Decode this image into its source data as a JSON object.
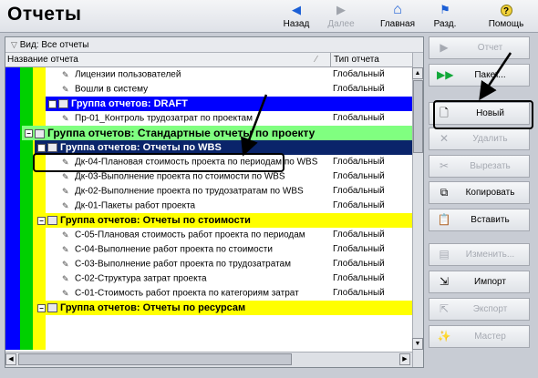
{
  "window": {
    "title": "Отчеты"
  },
  "nav": [
    {
      "label": "Назад",
      "icon": "arrow-left-icon",
      "glyph": "◀",
      "enabled": true
    },
    {
      "label": "Далее",
      "icon": "arrow-right-icon",
      "glyph": "▶",
      "enabled": false
    },
    {
      "label": "Главная",
      "icon": "home-icon",
      "glyph": "⌂",
      "enabled": true
    },
    {
      "label": "Разд.",
      "icon": "sections-icon",
      "glyph": "⚑",
      "enabled": true
    },
    {
      "label": "Помощь",
      "icon": "help-icon",
      "glyph": "?",
      "enabled": true
    }
  ],
  "view": {
    "label": "Вид: Все отчеты"
  },
  "columns": {
    "name": "Название отчета",
    "type": "Тип отчета"
  },
  "rows": [
    {
      "kind": "report",
      "name": "Лицензии пользователей",
      "type": "Глобальный"
    },
    {
      "kind": "report",
      "name": "Вошли в систему",
      "type": "Глобальный"
    },
    {
      "kind": "group",
      "name": "Группа отчетов: DRAFT",
      "type": ""
    },
    {
      "kind": "report",
      "name": "Пр-01_Контроль трудозатрат по проектам",
      "type": "Глобальный"
    },
    {
      "kind": "group",
      "name": "Группа отчетов: Стандартные отчеты по проекту",
      "type": ""
    },
    {
      "kind": "group",
      "name": "Группа отчетов: Отчеты по WBS",
      "type": ""
    },
    {
      "kind": "report",
      "name": "Дк-04-Плановая стоимость проекта по периодам по WBS",
      "type": "Глобальный"
    },
    {
      "kind": "report",
      "name": "Дк-03-Выполнение проекта по стоимости по WBS",
      "type": "Глобальный"
    },
    {
      "kind": "report",
      "name": "Дк-02-Выполнение проекта по трудозатратам по WBS",
      "type": "Глобальный"
    },
    {
      "kind": "report",
      "name": "Дк-01-Пакеты работ проекта",
      "type": "Глобальный"
    },
    {
      "kind": "group",
      "name": "Группа отчетов: Отчеты по стоимости",
      "type": ""
    },
    {
      "kind": "report",
      "name": "С-05-Плановая стоимость работ проекта по периодам",
      "type": "Глобальный"
    },
    {
      "kind": "report",
      "name": "С-04-Выполнение работ проекта по стоимости",
      "type": "Глобальный"
    },
    {
      "kind": "report",
      "name": "С-03-Выполнение работ проекта по трудозатратам",
      "type": "Глобальный"
    },
    {
      "kind": "report",
      "name": "С-02-Структура затрат проекта",
      "type": "Глобальный"
    },
    {
      "kind": "report",
      "name": "С-01-Стоимость работ проекта по категориям затрат",
      "type": "Глобальный"
    },
    {
      "kind": "group",
      "name": "Группа отчетов: Отчеты по ресурсам",
      "type": ""
    }
  ],
  "actions": [
    {
      "label": "Отчет",
      "icon": "run-report-icon",
      "glyph": "▶",
      "enabled": false
    },
    {
      "label": "Пакет...",
      "icon": "batch-icon",
      "glyph": "▶▶",
      "enabled": true
    },
    {
      "label": "Новый",
      "icon": "new-document-icon",
      "glyph": "🗋",
      "enabled": true
    },
    {
      "label": "Удалить",
      "icon": "delete-icon",
      "glyph": "✕",
      "enabled": false
    },
    {
      "label": "Вырезать",
      "icon": "cut-icon",
      "glyph": "✂",
      "enabled": false
    },
    {
      "label": "Копировать",
      "icon": "copy-icon",
      "glyph": "⧉",
      "enabled": true
    },
    {
      "label": "Вставить",
      "icon": "paste-icon",
      "glyph": "📋",
      "enabled": true
    },
    {
      "label": "Изменить...",
      "icon": "edit-icon",
      "glyph": "▤",
      "enabled": false
    },
    {
      "label": "Импорт",
      "icon": "import-icon",
      "glyph": "⇲",
      "enabled": true
    },
    {
      "label": "Экспорт",
      "icon": "export-icon",
      "glyph": "⇱",
      "enabled": false
    },
    {
      "label": "Мастер",
      "icon": "wizard-icon",
      "glyph": "✨",
      "enabled": false
    }
  ],
  "colors": {
    "group_draft": "#0000ff",
    "group_standard": "#80ff80",
    "group_selected": "#0a246a",
    "group_cost": "#ffff00",
    "group_resources": "#ffff00",
    "stripe_blue": "#0000ff",
    "stripe_green": "#00d000",
    "stripe_yellow": "#ffff00",
    "accent_green": "#12a83a",
    "accent_blue": "#1b5fd6"
  }
}
